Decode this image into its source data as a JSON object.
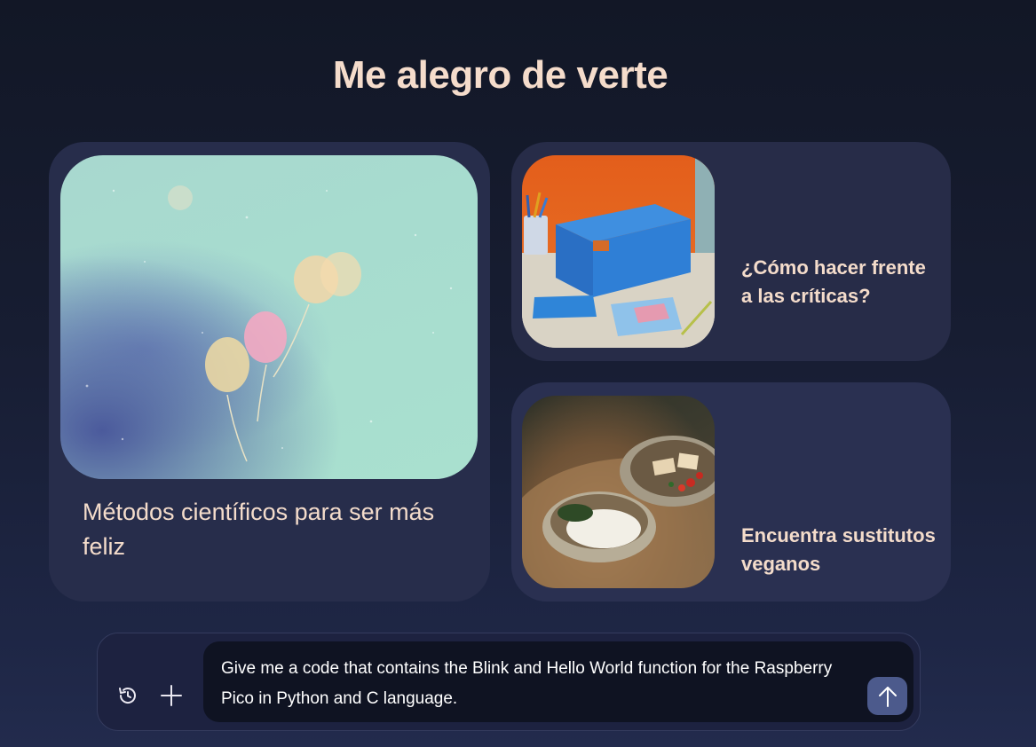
{
  "greeting": "Me alegro de verte",
  "cards": {
    "big": {
      "title": "Métodos científicos para ser más feliz",
      "image": "pastel-balloons-image"
    },
    "small1": {
      "title": "¿Cómo hacer frente a las críticas?",
      "image": "blue-box-desk-image"
    },
    "small2": {
      "title": "Encuentra sustitutos veganos",
      "image": "rice-tofu-bowls-image"
    }
  },
  "composer": {
    "input_value": "Give me a code that contains the Blink and Hello World function for the Raspberry Pico in Python and C language.",
    "history_icon": "history-icon",
    "plus_icon": "plus-icon",
    "send_icon": "arrow-up-icon"
  },
  "colors": {
    "background_top": "#121726",
    "background_bottom": "#222b4d",
    "card": "#272d4b",
    "text_accent": "#f5dccb",
    "send_button": "#4c5a8c"
  }
}
